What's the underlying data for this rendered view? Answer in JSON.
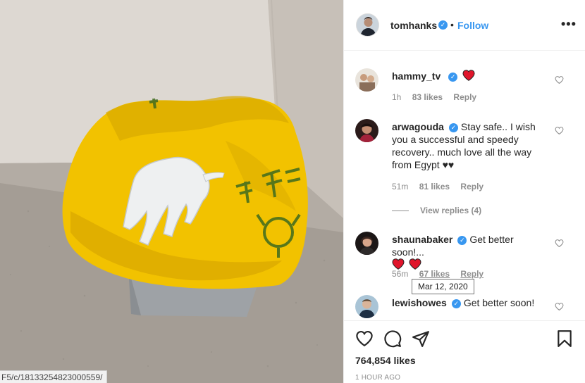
{
  "post": {
    "author": "tomhanks",
    "verified_mark": "✓",
    "separator": "•",
    "follow_label": "Follow",
    "more_label": "•••",
    "likes_count": "764,854 likes",
    "time_ago": "1 HOUR AGO",
    "tooltip_date": "Mar 12, 2020"
  },
  "browser": {
    "status_url": "F5/c/18133254823000559/"
  },
  "comments": [
    {
      "username": "hammy_tv",
      "verified": true,
      "text": "",
      "hearts": 1,
      "time": "1h",
      "likes": "83 likes",
      "reply": "Reply"
    },
    {
      "username": "arwagouda",
      "verified": true,
      "text": "Stay safe.. I wish you a successful and speedy recovery.. much love all the way from Egypt ♥♥",
      "time": "51m",
      "likes": "81 likes",
      "reply": "Reply"
    },
    {
      "username": "shaunabaker",
      "verified": true,
      "text": "Get better soon!...",
      "hearts": 2,
      "time": "56m",
      "likes": "67 likes",
      "reply": "Reply"
    },
    {
      "username": "lewishowes",
      "verified": true,
      "text": "Get better soon!"
    }
  ],
  "view_replies": "View replies (4)",
  "icons": {
    "like": "heart-icon",
    "comment": "comment-icon",
    "share": "share-icon",
    "save": "bookmark-icon"
  },
  "colors": {
    "link_blue": "#3897f0",
    "muted_text": "#8e8e8e",
    "heart_red": "#ed4956",
    "bag_yellow": "#f2c200"
  }
}
